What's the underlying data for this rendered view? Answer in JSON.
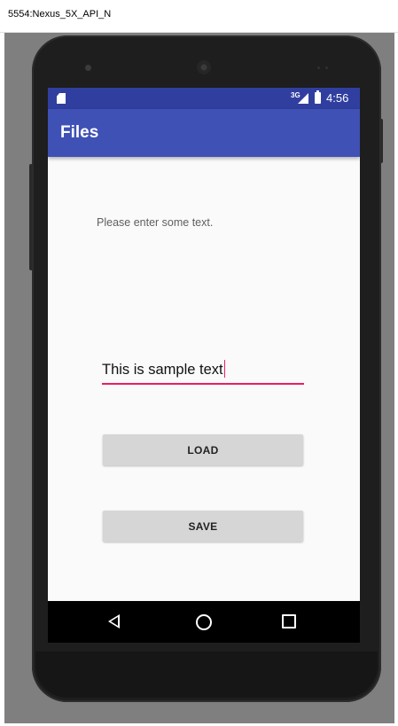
{
  "window": {
    "title": "5554:Nexus_5X_API_N"
  },
  "status_bar": {
    "network": "3G",
    "time": "4:56",
    "color": "#303f9f"
  },
  "action_bar": {
    "title": "Files",
    "color": "#3f51b5"
  },
  "content": {
    "prompt": "Please enter some text.",
    "input_value": "This is sample text",
    "input_accent_color": "#e91e63",
    "load_button": "LOAD",
    "save_button": "SAVE"
  },
  "navigation_bar": {
    "back": "back-icon",
    "home": "home-icon",
    "recents": "recents-icon"
  }
}
